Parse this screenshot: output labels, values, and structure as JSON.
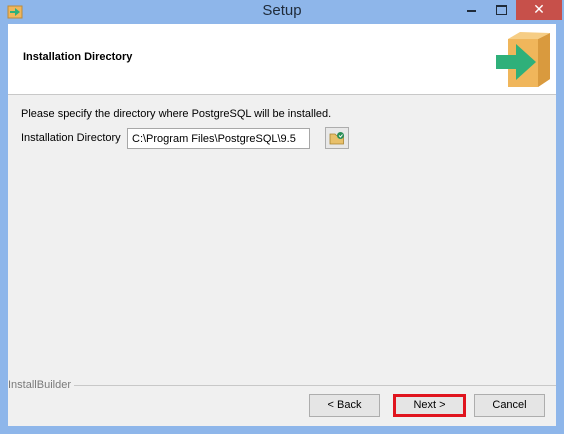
{
  "window": {
    "title": "Setup",
    "close_glyph": "✕"
  },
  "header": {
    "title": "Installation Directory",
    "icon": "installer-box-arrow-icon"
  },
  "content": {
    "description": "Please specify the directory where PostgreSQL will be installed.",
    "directory_label": "Installation Directory",
    "directory_value": "C:\\Program Files\\PostgreSQL\\9.5"
  },
  "footer": {
    "brand": "InstallBuilder",
    "back_label": "< Back",
    "next_label": "Next >",
    "cancel_label": "Cancel"
  },
  "colors": {
    "titlebar": "#8eb6ea",
    "close": "#c7504a",
    "highlight": "#e0141e",
    "arrow": "#2fb07a",
    "box": "#f0b65b"
  }
}
